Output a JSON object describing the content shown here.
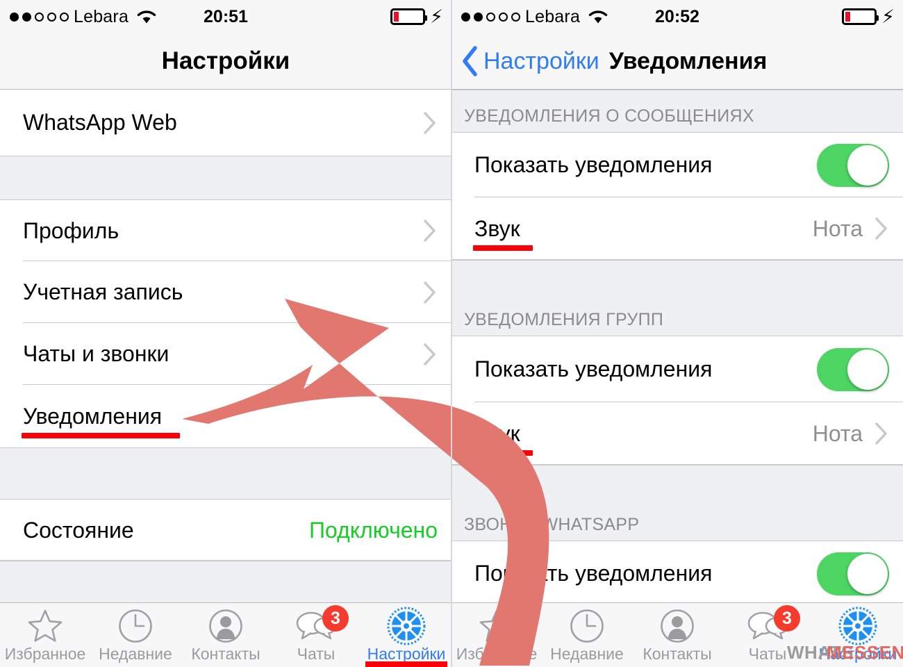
{
  "left": {
    "status_bar": {
      "signal_dots_filled": 2,
      "signal_dots_total": 5,
      "carrier": "Lebara",
      "wifi_icon": "wifi-icon",
      "time": "20:51",
      "battery_icon": "battery-low-icon",
      "charging_icon": "lightning-bolt-icon"
    },
    "nav": {
      "title": "Настройки"
    },
    "rows": [
      {
        "label": "WhatsApp Web",
        "accessory": "chevron"
      },
      {
        "label": "Профиль",
        "accessory": "chevron"
      },
      {
        "label": "Учетная запись",
        "accessory": "chevron"
      },
      {
        "label": "Чаты и звонки",
        "accessory": "chevron"
      },
      {
        "label": "Уведомления",
        "accessory": "chevron",
        "underlined": true
      },
      {
        "label": "Состояние",
        "value": "Подключено",
        "value_color": "#16cd27"
      }
    ]
  },
  "right": {
    "status_bar": {
      "signal_dots_filled": 2,
      "signal_dots_total": 5,
      "carrier": "Lebara",
      "wifi_icon": "wifi-icon",
      "time": "20:52",
      "battery_icon": "battery-low-icon",
      "charging_icon": "lightning-bolt-icon"
    },
    "nav": {
      "back_icon": "chevron-left-icon",
      "back_label": "Настройки",
      "title": "Уведомления"
    },
    "sections": [
      {
        "header": "УВЕДОМЛЕНИЯ О СООБЩЕНИЯХ",
        "rows": [
          {
            "label": "Показать уведомления",
            "control": "toggle",
            "toggle_on": true
          },
          {
            "label": "Звук",
            "value": "Нота",
            "accessory": "chevron",
            "underlined": true
          }
        ]
      },
      {
        "header": "УВЕДОМЛЕНИЯ ГРУПП",
        "rows": [
          {
            "label": "Показать уведомления",
            "control": "toggle",
            "toggle_on": true
          },
          {
            "label": "Звук",
            "value": "Нота",
            "accessory": "chevron",
            "underlined": true
          }
        ]
      },
      {
        "header": "ЗВОНОК WHATSAPP",
        "rows": [
          {
            "label": "Показать уведомления",
            "control": "toggle",
            "toggle_on": true
          }
        ]
      }
    ]
  },
  "tabbar": {
    "tabs": [
      {
        "icon": "star-icon",
        "label": "Избранное"
      },
      {
        "icon": "clock-icon",
        "label": "Недавние"
      },
      {
        "icon": "contact-icon",
        "label": "Контакты"
      },
      {
        "icon": "chats-icon",
        "label": "Чаты",
        "badge": "3"
      },
      {
        "icon": "gear-icon",
        "label": "Настройки",
        "active": true
      }
    ]
  },
  "annotation": {
    "arrow_color": "#e2776f",
    "underline_color": "#fb0007",
    "description": "curved-arrow-from-right-panel-to-uvedomleniya-row"
  },
  "watermark": {
    "part1": "WHATS",
    "part2": "MESSENGER"
  },
  "colors": {
    "toggle_on": "#4cd562",
    "accent_blue": "#2f7cf6",
    "status_green": "#16cd27",
    "badge_red": "#f63a2e",
    "group_bg": "#eff0f4"
  }
}
